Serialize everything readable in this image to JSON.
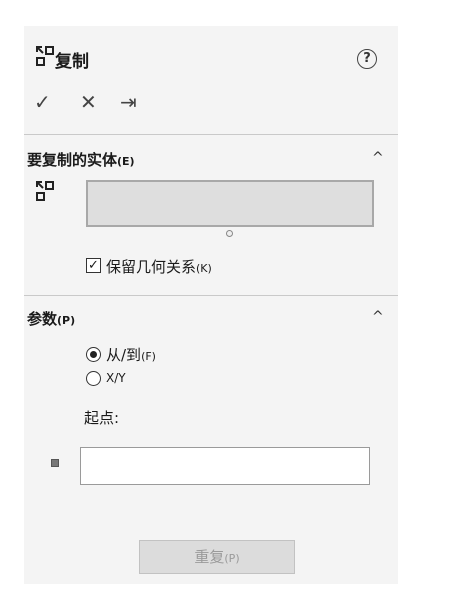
{
  "header": {
    "title": "复制",
    "help_symbol": "?"
  },
  "toolbar": {
    "ok_symbol": "✓",
    "cancel_symbol": "✕",
    "pin_symbol": "⇥"
  },
  "entities_section": {
    "title": "要复制的实体",
    "accel": "(E)",
    "collapse_symbol": "^",
    "keep_relations": {
      "label": "保留几何关系",
      "accel": "(K)",
      "checked": true
    }
  },
  "params_section": {
    "title": "参数",
    "accel": "(P)",
    "collapse_symbol": "^",
    "options": [
      {
        "label": "从/到",
        "accel": "(F)",
        "selected": true
      },
      {
        "label": "X/Y",
        "accel": "",
        "selected": false
      }
    ],
    "start_point_label": "起点:",
    "start_point_value": ""
  },
  "repeat_button": {
    "label": "重复",
    "accel": "(P)"
  }
}
